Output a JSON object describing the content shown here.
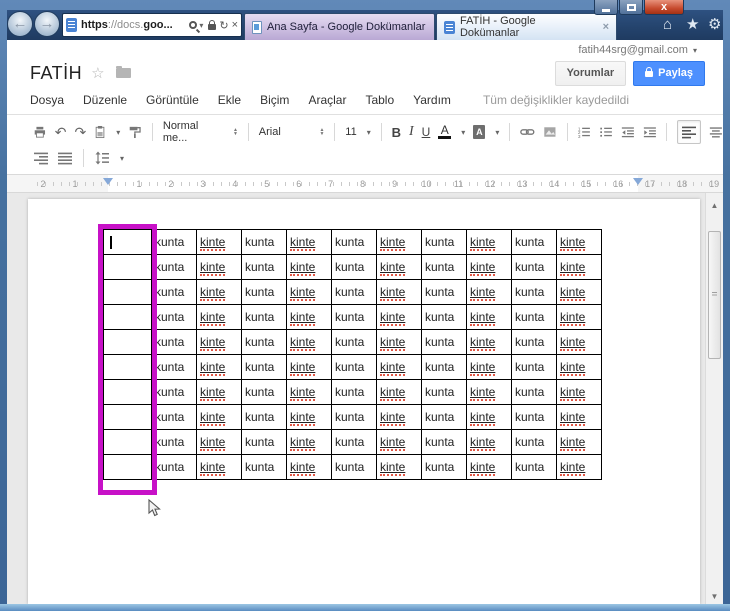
{
  "browser": {
    "url": {
      "scheme": "https",
      "separator": "://docs.",
      "domain": "goo..."
    },
    "tabs": [
      {
        "label": "Ana Sayfa - Google Dokümanlar",
        "active": false
      },
      {
        "label": "FATİH - Google Dokümanlar",
        "active": true
      }
    ]
  },
  "docs": {
    "account": "fatih44srg@gmail.com",
    "title": "FATİH",
    "menu_items": [
      "Dosya",
      "Düzenle",
      "Görüntüle",
      "Ekle",
      "Biçim",
      "Araçlar",
      "Tablo",
      "Yardım"
    ],
    "save_status": "Tüm değişiklikler kaydedildi",
    "comments_button": "Yorumlar",
    "share_button": "Paylaş",
    "toolbar": {
      "style": "Normal me...",
      "font": "Arial",
      "size": "11",
      "bold": "B",
      "italic": "I",
      "underline": "U",
      "text_color": "A",
      "highlight": "A"
    }
  },
  "ruler": {
    "margin_numbers": [
      "2",
      "1"
    ],
    "numbers": [
      "1",
      "2",
      "3",
      "4",
      "5",
      "6",
      "7",
      "8",
      "9",
      "10",
      "11",
      "12",
      "13",
      "14",
      "15",
      "16",
      "17",
      "18",
      "19"
    ]
  },
  "table": {
    "row_count": 10,
    "column_words": [
      "",
      "kunta",
      "kinte",
      "kunta",
      "kinte",
      "kunta",
      "kinte",
      "kunta",
      "kinte",
      "kunta",
      "kinte"
    ],
    "underlined_word": "kinte"
  },
  "icons": {
    "back": "←",
    "forward": "→",
    "dropdown": "▾",
    "refresh": "↻",
    "stop": "×",
    "home": "⌂",
    "star": "★",
    "gear": "⚙",
    "star_outline": "☆",
    "tab_close": "×",
    "undo": "↶",
    "redo": "↷",
    "up": "▲",
    "down": "▼"
  },
  "colors": {
    "share_blue": "#4d90fe",
    "magenta": "#c711c7",
    "spellcheck_red": "#e25745",
    "tab_inactive": "#c9bcdf",
    "frame_blue": "#46719f"
  }
}
